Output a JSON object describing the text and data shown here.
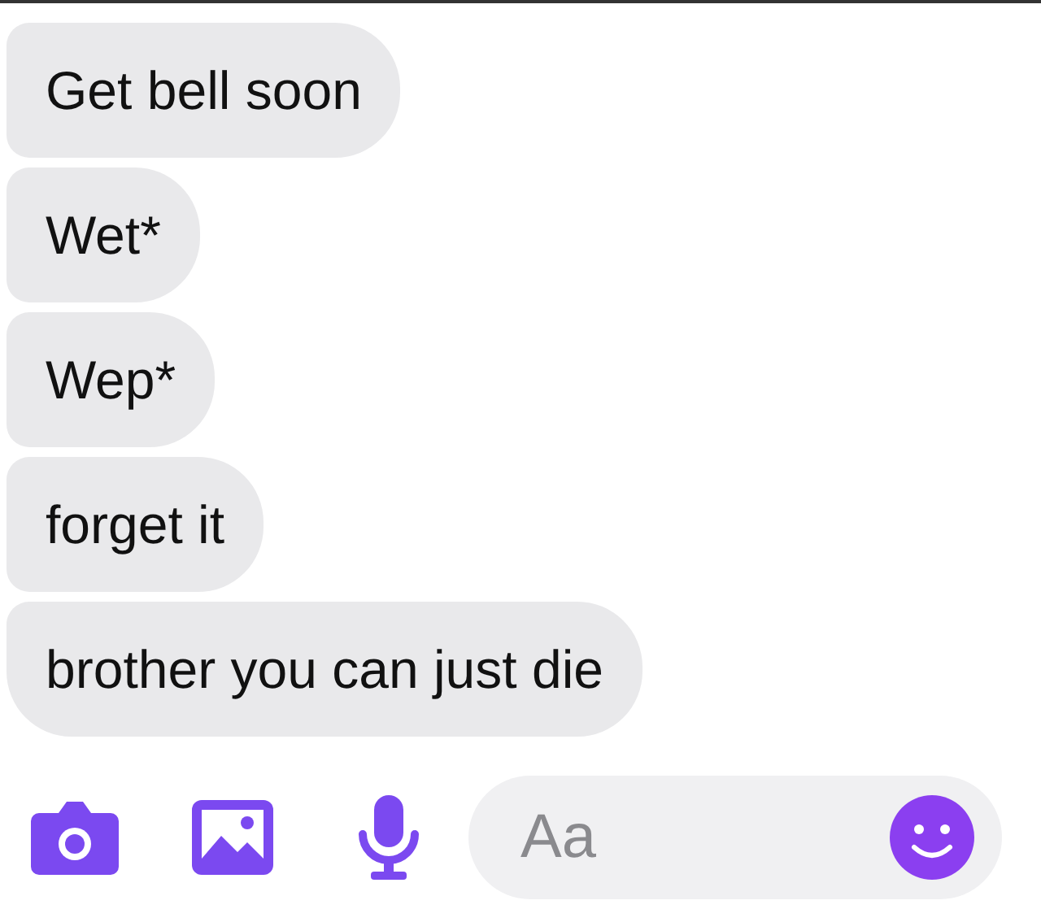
{
  "messages": [
    {
      "text": "Get bell soon"
    },
    {
      "text": "Wet*"
    },
    {
      "text": "Wep*"
    },
    {
      "text": "forget it"
    },
    {
      "text": "brother you can just die"
    }
  ],
  "composer": {
    "placeholder": "Aa"
  }
}
